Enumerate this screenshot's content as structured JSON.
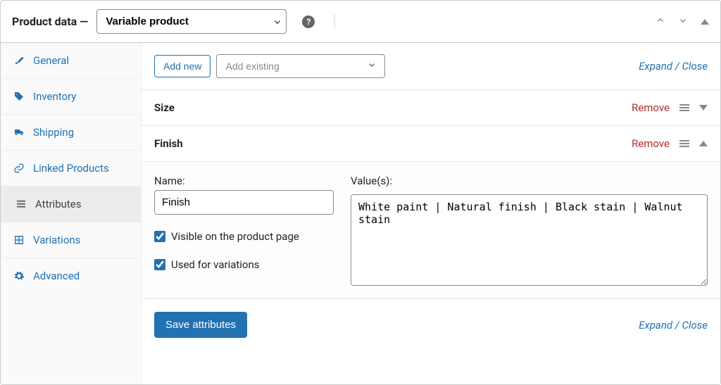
{
  "header": {
    "title": "Product data —",
    "product_type": "Variable product"
  },
  "toolbar": {
    "add_new": "Add new",
    "add_existing_placeholder": "Add existing",
    "expand": "Expand",
    "close": "Close",
    "separator": " / "
  },
  "tabs": {
    "general": "General",
    "inventory": "Inventory",
    "shipping": "Shipping",
    "linked": "Linked Products",
    "attributes": "Attributes",
    "variations": "Variations",
    "advanced": "Advanced"
  },
  "attrs": {
    "size": {
      "name": "Size",
      "remove": "Remove"
    },
    "finish": {
      "name": "Finish",
      "remove": "Remove",
      "name_label": "Name:",
      "name_value": "Finish",
      "values_label": "Value(s):",
      "values_text": "White paint | Natural finish | Black stain | Walnut stain",
      "visible_label": "Visible on the product page",
      "used_label": "Used for variations"
    }
  },
  "footer": {
    "save": "Save attributes",
    "expand": "Expand",
    "close": "Close",
    "separator": " / "
  }
}
